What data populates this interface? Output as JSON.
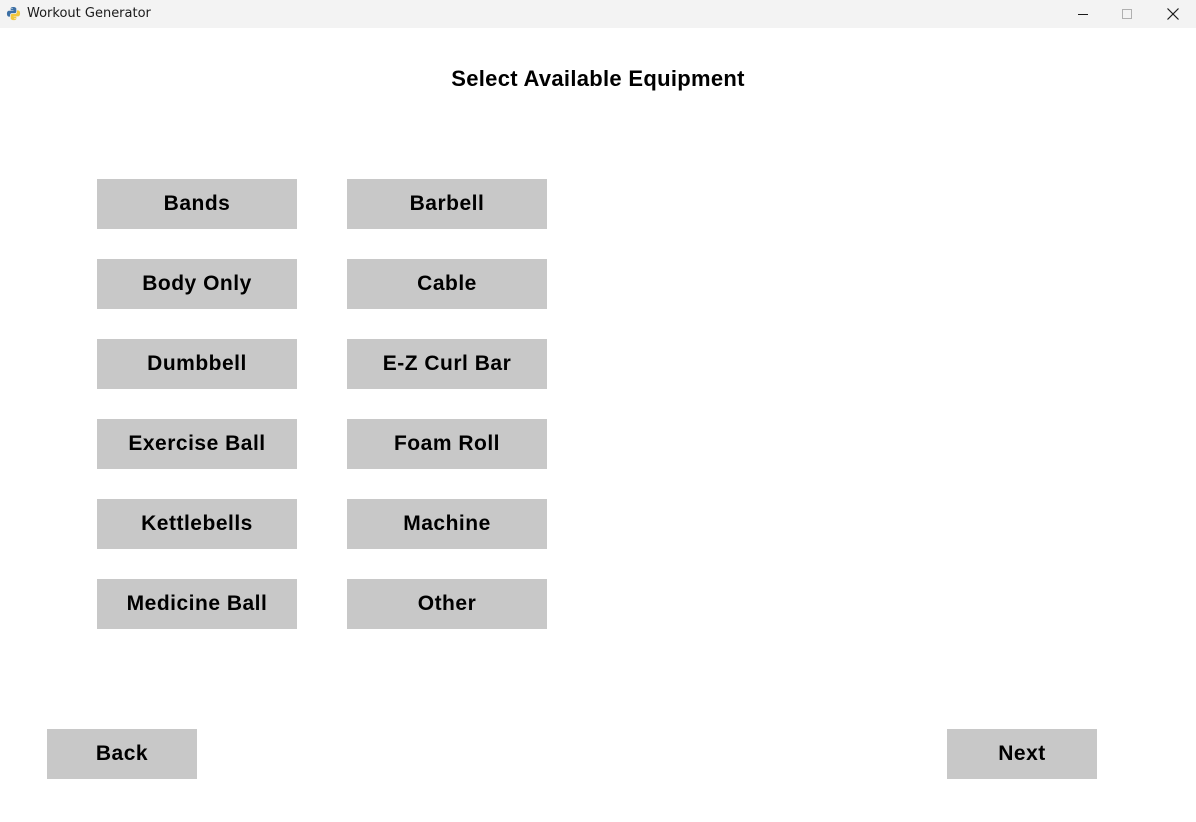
{
  "window": {
    "title": "Workout Generator",
    "icons": [
      "python-icon",
      "minimize-icon",
      "maximize-icon",
      "close-icon"
    ]
  },
  "page": {
    "title": "Select Available Equipment"
  },
  "equipment": [
    "Bands",
    "Barbell",
    "Body Only",
    "Cable",
    "Dumbbell",
    "E-Z Curl Bar",
    "Exercise Ball",
    "Foam Roll",
    "Kettlebells",
    "Machine",
    "Medicine Ball",
    "Other"
  ],
  "nav": {
    "back_label": "Back",
    "next_label": "Next"
  },
  "colors": {
    "button_bg": "#c8c8c8",
    "background": "#ffffff",
    "titlebar_bg": "#f3f3f3"
  }
}
